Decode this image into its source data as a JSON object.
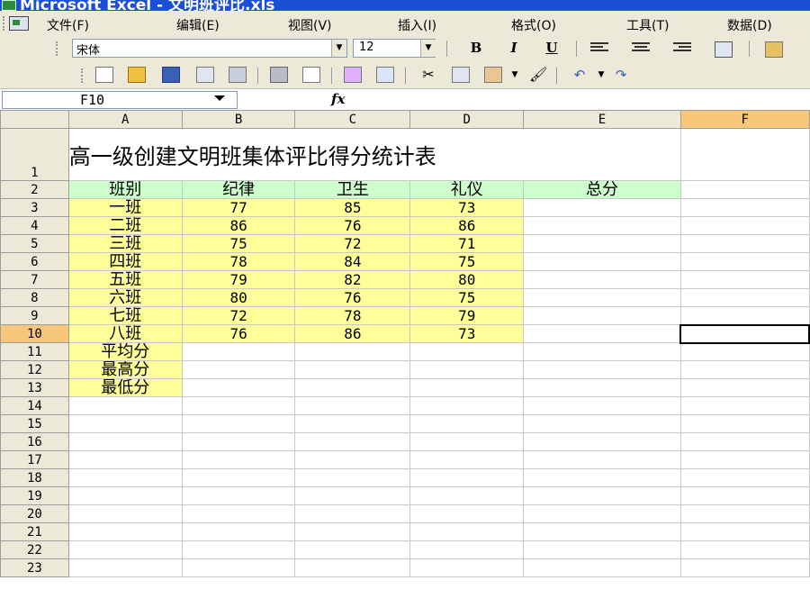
{
  "titlebar": {
    "text": "Microsoft Excel - 文明班评比.xls"
  },
  "menu": [
    "文件(F)",
    "编辑(E)",
    "视图(V)",
    "插入(I)",
    "格式(O)",
    "工具(T)",
    "数据(D)"
  ],
  "format_toolbar": {
    "font_name": "宋体",
    "font_size": "12",
    "bold": "B",
    "italic": "I",
    "underline": "U"
  },
  "formula_bar": {
    "name_box": "F10",
    "fx": "fx",
    "formula": ""
  },
  "sheet": {
    "columns": [
      "A",
      "B",
      "C",
      "D",
      "E",
      "F"
    ],
    "active_column": "F",
    "active_row": "10",
    "title": "高一级创建文明班集体评比得分统计表",
    "header": [
      "班别",
      "纪律",
      "卫生",
      "礼仪",
      "总分"
    ],
    "rows": [
      {
        "row": "3",
        "class": "一班",
        "discipline": "77",
        "hygiene": "85",
        "etiquette": "73"
      },
      {
        "row": "4",
        "class": "二班",
        "discipline": "86",
        "hygiene": "76",
        "etiquette": "86"
      },
      {
        "row": "5",
        "class": "三班",
        "discipline": "75",
        "hygiene": "72",
        "etiquette": "71"
      },
      {
        "row": "6",
        "class": "四班",
        "discipline": "78",
        "hygiene": "84",
        "etiquette": "75"
      },
      {
        "row": "7",
        "class": "五班",
        "discipline": "79",
        "hygiene": "82",
        "etiquette": "80"
      },
      {
        "row": "8",
        "class": "六班",
        "discipline": "80",
        "hygiene": "76",
        "etiquette": "75"
      },
      {
        "row": "9",
        "class": "七班",
        "discipline": "72",
        "hygiene": "78",
        "etiquette": "79"
      },
      {
        "row": "10",
        "class": "八班",
        "discipline": "76",
        "hygiene": "86",
        "etiquette": "73"
      }
    ],
    "stats": [
      {
        "row": "11",
        "label": "平均分"
      },
      {
        "row": "12",
        "label": "最高分"
      },
      {
        "row": "13",
        "label": "最低分"
      }
    ],
    "empty_rows": [
      "14",
      "15",
      "16",
      "17",
      "18",
      "19",
      "20",
      "21",
      "22",
      "23"
    ]
  }
}
